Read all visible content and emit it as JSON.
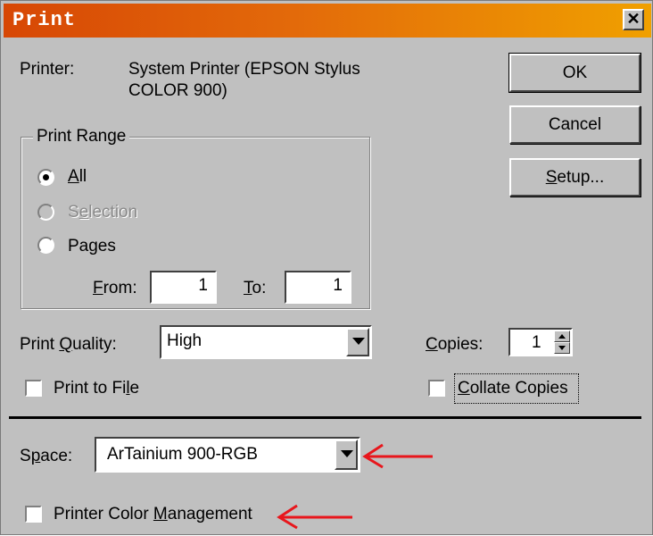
{
  "window": {
    "title": "Print",
    "close_label": "✕"
  },
  "printer": {
    "label": "Printer:",
    "value_line1": "System Printer (EPSON Stylus",
    "value_line2": "COLOR 900)"
  },
  "buttons": {
    "ok": "OK",
    "cancel": "Cancel",
    "setup_key": "S",
    "setup_rest": "etup..."
  },
  "print_range": {
    "label": "Print Range",
    "all": {
      "key": "A",
      "rest": "ll",
      "selected": true
    },
    "selection": {
      "pre": "S",
      "key": "e",
      "rest": "lection",
      "enabled": false
    },
    "pages": {
      "label": "Pages"
    },
    "from": {
      "key": "F",
      "rest": "rom:",
      "value": "1"
    },
    "to": {
      "key": "T",
      "rest": "o:",
      "value": "1"
    }
  },
  "print_quality": {
    "pre": "Print ",
    "key": "Q",
    "rest": "uality:",
    "value": "High"
  },
  "copies": {
    "key": "C",
    "rest": "opies:",
    "value": "1"
  },
  "print_to_file": {
    "pre": "Print to Fi",
    "key": "l",
    "rest": "e",
    "checked": false
  },
  "collate": {
    "key": "C",
    "rest": "ollate Copies",
    "checked": false
  },
  "space": {
    "pre": "S",
    "key": "p",
    "rest": "ace:",
    "value": "ArTainium 900-RGB"
  },
  "printer_color_management": {
    "pre": "Printer Color ",
    "key": "M",
    "rest": "anagement",
    "checked": false
  },
  "annotation_color": "#e8161c"
}
